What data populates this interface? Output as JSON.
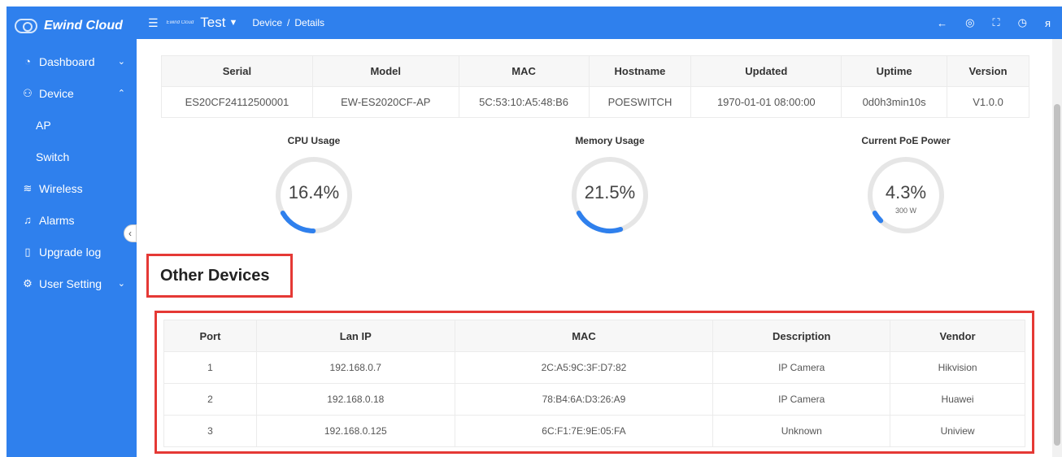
{
  "sidebar": {
    "brand": "Ewind Cloud",
    "items": [
      {
        "label": "Dashboard",
        "icon": "dashboard-icon"
      },
      {
        "label": "Device",
        "icon": "device-icon"
      },
      {
        "label": "AP"
      },
      {
        "label": "Switch"
      },
      {
        "label": "Wireless",
        "icon": "wifi-icon"
      },
      {
        "label": "Alarms",
        "icon": "bell-icon"
      },
      {
        "label": "Upgrade log",
        "icon": "file-icon"
      },
      {
        "label": "User Setting",
        "icon": "gear-icon"
      }
    ]
  },
  "header": {
    "small_brand": "Ewind Cloud",
    "project": "Test",
    "breadcrumb": [
      "Device",
      "Details"
    ],
    "icons": [
      "back-icon",
      "eye-icon",
      "fullscreen-icon",
      "clock-icon",
      "user-icon"
    ]
  },
  "info_table": {
    "columns": [
      "Serial",
      "Model",
      "MAC",
      "Hostname",
      "Updated",
      "Uptime",
      "Version"
    ],
    "row": [
      "ES20CF24112500001",
      "EW-ES2020CF-AP",
      "5C:53:10:A5:48:B6",
      "POESWITCH",
      "1970-01-01 08:00:00",
      "0d0h3min10s",
      "V1.0.0"
    ]
  },
  "gauges": [
    {
      "title": "CPU Usage",
      "value": "16.4%",
      "percent": 16.4,
      "sub": ""
    },
    {
      "title": "Memory Usage",
      "value": "21.5%",
      "percent": 21.5,
      "sub": ""
    },
    {
      "title": "Current PoE Power",
      "value": "4.3%",
      "percent": 4.3,
      "sub": "300 W"
    }
  ],
  "other_devices": {
    "title": "Other Devices",
    "columns": [
      "Port",
      "Lan IP",
      "MAC",
      "Description",
      "Vendor"
    ],
    "rows": [
      [
        "1",
        "192.168.0.7",
        "2C:A5:9C:3F:D7:82",
        "IP Camera",
        "Hikvision"
      ],
      [
        "2",
        "192.168.0.18",
        "78:B4:6A:D3:26:A9",
        "IP Camera",
        "Huawei"
      ],
      [
        "3",
        "192.168.0.125",
        "6C:F1:7E:9E:05:FA",
        "Unknown",
        "Uniview"
      ]
    ]
  },
  "colors": {
    "primary": "#2f80ed",
    "highlight": "#e53935",
    "gauge_track": "#e6e6e6"
  }
}
